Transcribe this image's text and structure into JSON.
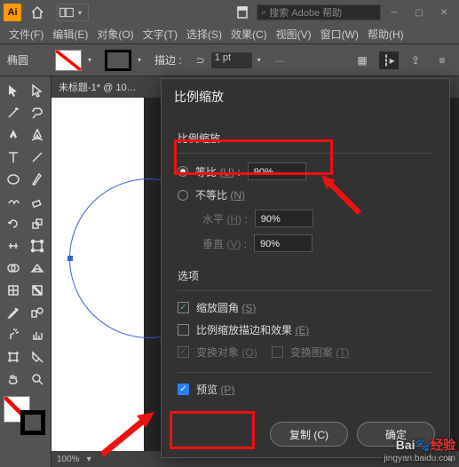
{
  "titlebar": {
    "logo": "Ai",
    "search_placeholder": "搜索 Adobe 帮助"
  },
  "menu": {
    "file": "文件(F)",
    "edit": "编辑(E)",
    "object": "对象(O)",
    "type": "文字(T)",
    "select": "选择(S)",
    "effect": "效果(C)",
    "view": "视图(V)",
    "window": "窗口(W)",
    "help": "帮助(H)"
  },
  "options": {
    "tool_name": "椭圆",
    "stroke_label": "描边 :",
    "stroke_weight": "1 pt"
  },
  "tab": {
    "title": "未标题-1* @ 10…"
  },
  "statusbar": {
    "zoom": "100%"
  },
  "dialog": {
    "title": "比例缩放",
    "section_scale": "比例缩放",
    "uniform_label": "等比",
    "uniform_hint": "(U)",
    "uniform_value": "90%",
    "nonuniform_label": "不等比",
    "nonuniform_hint": "(N)",
    "horiz_label": "水平",
    "horiz_hint": "(H)",
    "horiz_value": "90%",
    "vert_label": "垂直",
    "vert_hint": "(V)",
    "vert_value": "90%",
    "section_options": "选项",
    "opt_scalecorners": "缩放圆角",
    "opt_scalecorners_hint": "(S)",
    "opt_scalestroke": "比例缩放描边和效果",
    "opt_scalestroke_hint": "(E)",
    "opt_transformobj": "变换对象",
    "opt_transformobj_hint": "(O)",
    "opt_transformpat": "变换图案",
    "opt_transformpat_hint": "(T)",
    "preview_label": "预览",
    "preview_hint": "(P)",
    "btn_copy": "复制 (C)",
    "btn_ok": "确定"
  },
  "watermark": {
    "brand_a": "Bai",
    "brand_b": "经验",
    "url": "jingyan.baidu.com"
  }
}
